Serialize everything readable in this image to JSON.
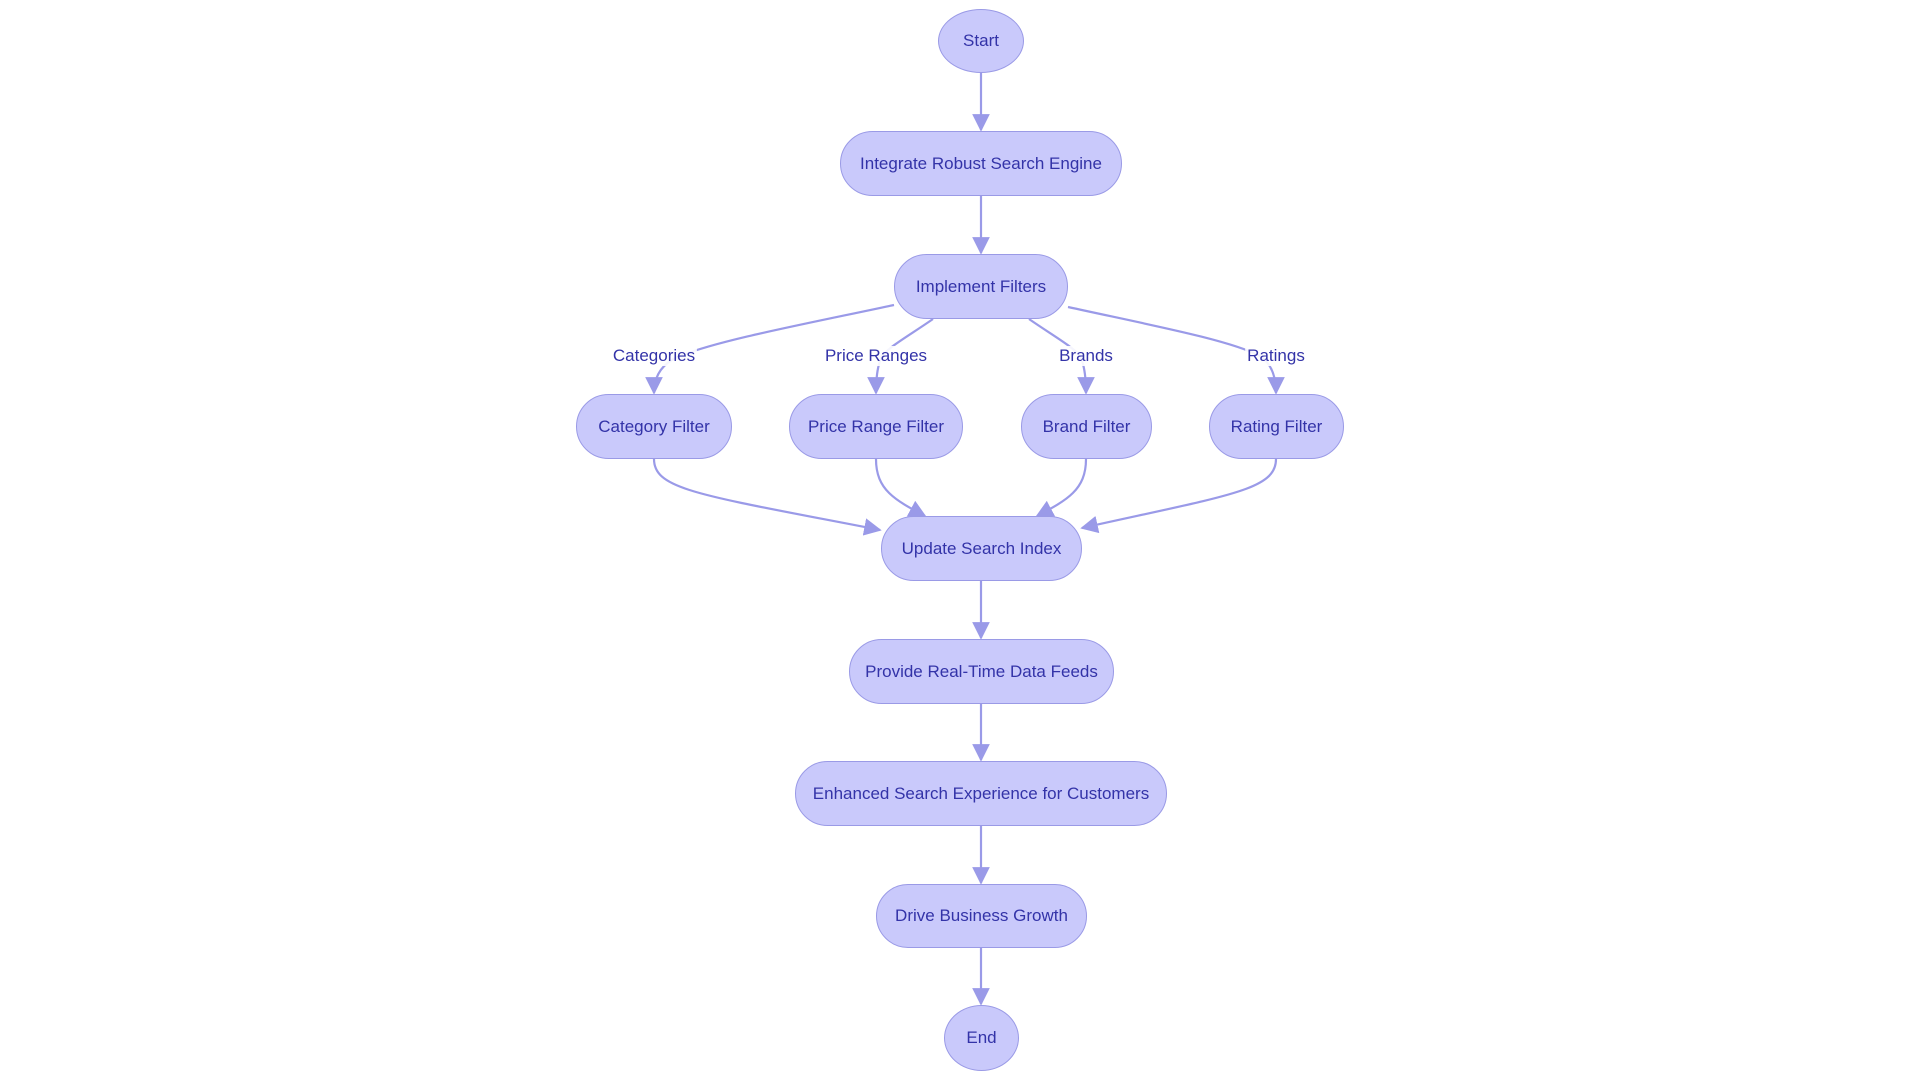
{
  "diagram": {
    "type": "flowchart",
    "colors": {
      "node_fill": "#c9c9fb",
      "node_stroke": "#9a9ae6",
      "text": "#3333a8",
      "edge": "#9a9ae8"
    },
    "nodes": {
      "start": "Start",
      "integrate": "Integrate Robust Search Engine",
      "implement": "Implement Filters",
      "category": "Category Filter",
      "price": "Price Range Filter",
      "brand": "Brand Filter",
      "rating": "Rating Filter",
      "update": "Update Search Index",
      "provide": "Provide Real-Time Data Feeds",
      "enhanced": "Enhanced Search Experience for Customers",
      "drive": "Drive Business Growth",
      "end": "End"
    },
    "edge_labels": {
      "categories": "Categories",
      "price_ranges": "Price Ranges",
      "brands": "Brands",
      "ratings": "Ratings"
    },
    "edges": [
      {
        "from": "start",
        "to": "integrate"
      },
      {
        "from": "integrate",
        "to": "implement"
      },
      {
        "from": "implement",
        "to": "category",
        "label": "Categories"
      },
      {
        "from": "implement",
        "to": "price",
        "label": "Price Ranges"
      },
      {
        "from": "implement",
        "to": "brand",
        "label": "Brands"
      },
      {
        "from": "implement",
        "to": "rating",
        "label": "Ratings"
      },
      {
        "from": "category",
        "to": "update"
      },
      {
        "from": "price",
        "to": "update"
      },
      {
        "from": "brand",
        "to": "update"
      },
      {
        "from": "rating",
        "to": "update"
      },
      {
        "from": "update",
        "to": "provide"
      },
      {
        "from": "provide",
        "to": "enhanced"
      },
      {
        "from": "enhanced",
        "to": "drive"
      },
      {
        "from": "drive",
        "to": "end"
      }
    ]
  }
}
